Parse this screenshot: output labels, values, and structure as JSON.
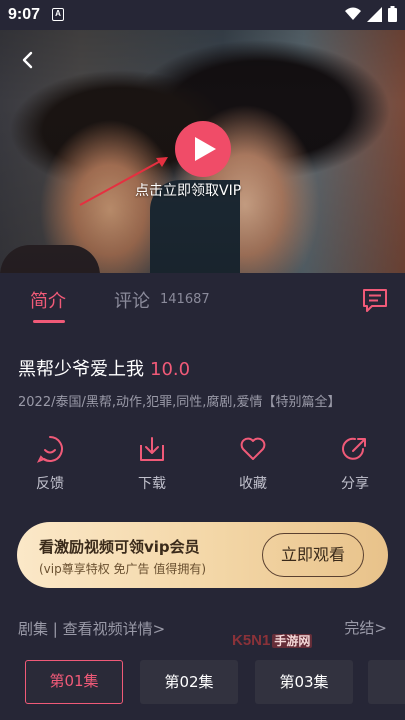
{
  "status_bar": {
    "time": "9:07",
    "notification_badge": "A",
    "icons": [
      "wifi-icon",
      "signal-icon",
      "battery-icon"
    ]
  },
  "player": {
    "play_hint": "点击立即领取VIP"
  },
  "tabs": {
    "intro_label": "简介",
    "comments_label": "评论",
    "comments_count": "141687"
  },
  "show": {
    "title": "黑帮少爷爱上我",
    "score": "10.0",
    "meta": "2022/泰国/黑帮,动作,犯罪,同性,腐剧,爱情【特别篇全】"
  },
  "actions": [
    {
      "label": "反馈",
      "icon": "feedback-icon"
    },
    {
      "label": "下载",
      "icon": "download-icon"
    },
    {
      "label": "收藏",
      "icon": "heart-icon"
    },
    {
      "label": "分享",
      "icon": "share-icon"
    }
  ],
  "vip_banner": {
    "title": "看激励视频可领vip会员",
    "subtitle": "(vip尊享特权 免广告 值得拥有)",
    "button_label": "立即观看"
  },
  "episodes": {
    "header": "剧集 | 查看视频详情>",
    "status": "完结>",
    "items": [
      "第01集",
      "第02集",
      "第03集",
      ""
    ],
    "selected_index": 0
  },
  "watermark": {
    "brand": "K5N1",
    "tag": "手游网"
  },
  "colors": {
    "background": "#262636",
    "accent": "#f05a78",
    "vip_gold": "#f3d6a6"
  }
}
